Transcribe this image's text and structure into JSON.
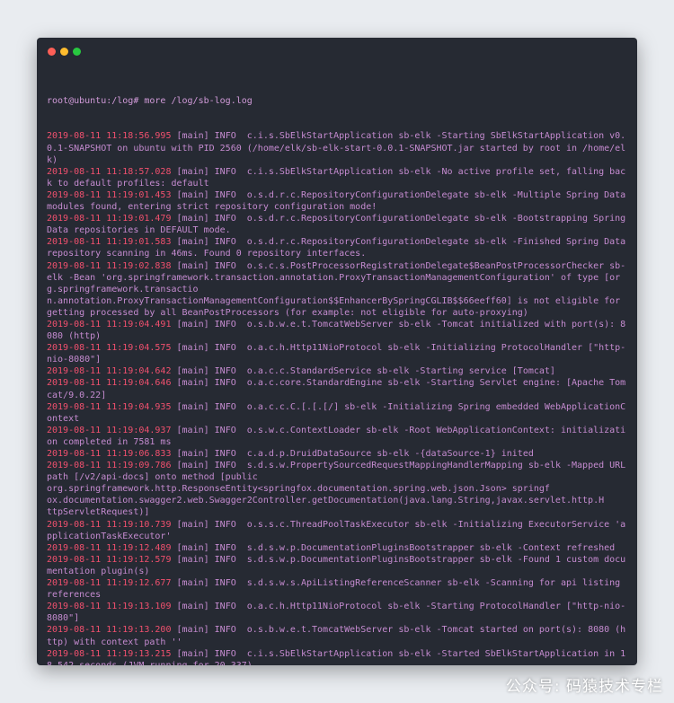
{
  "window": {
    "buttons": [
      "close",
      "minimize",
      "maximize"
    ]
  },
  "terminal": {
    "prompt": "root@ubuntu:/log# more /log/sb-log.log",
    "log": [
      {
        "ts": "2019-08-11 11:18:56.995",
        "msg": " [main] INFO  c.i.s.SbElkStartApplication sb-elk -Starting SbElkStartApplication v0.0.1-SNAPSHOT on ubuntu with PID 2560 (/home/elk/sb-elk-start-0.0.1-SNAPSHOT.jar started by root in /home/elk)"
      },
      {
        "ts": "2019-08-11 11:18:57.028",
        "msg": " [main] INFO  c.i.s.SbElkStartApplication sb-elk -No active profile set, falling back to default profiles: default"
      },
      {
        "ts": "2019-08-11 11:19:01.453",
        "msg": " [main] INFO  o.s.d.r.c.RepositoryConfigurationDelegate sb-elk -Multiple Spring Data modules found, entering strict repository configuration mode!"
      },
      {
        "ts": "2019-08-11 11:19:01.479",
        "msg": " [main] INFO  o.s.d.r.c.RepositoryConfigurationDelegate sb-elk -Bootstrapping Spring Data repositories in DEFAULT mode."
      },
      {
        "ts": "2019-08-11 11:19:01.583",
        "msg": " [main] INFO  o.s.d.r.c.RepositoryConfigurationDelegate sb-elk -Finished Spring Data repository scanning in 46ms. Found 0 repository interfaces."
      },
      {
        "ts": "2019-08-11 11:19:02.838",
        "msg": " [main] INFO  o.s.c.s.PostProcessorRegistrationDelegate$BeanPostProcessorChecker sb-elk -Bean 'org.springframework.transaction.annotation.ProxyTransactionManagementConfiguration' of type [org.springframework.transactio\nn.annotation.ProxyTransactionManagementConfiguration$$EnhancerBySpringCGLIB$$66eeff60] is not eligible for getting processed by all BeanPostProcessors (for example: not eligible for auto-proxying)"
      },
      {
        "ts": "2019-08-11 11:19:04.491",
        "msg": " [main] INFO  o.s.b.w.e.t.TomcatWebServer sb-elk -Tomcat initialized with port(s): 8080 (http)"
      },
      {
        "ts": "2019-08-11 11:19:04.575",
        "msg": " [main] INFO  o.a.c.h.Http11NioProtocol sb-elk -Initializing ProtocolHandler [\"http-nio-8080\"]"
      },
      {
        "ts": "2019-08-11 11:19:04.642",
        "msg": " [main] INFO  o.a.c.c.StandardService sb-elk -Starting service [Tomcat]"
      },
      {
        "ts": "2019-08-11 11:19:04.646",
        "msg": " [main] INFO  o.a.c.core.StandardEngine sb-elk -Starting Servlet engine: [Apache Tomcat/9.0.22]"
      },
      {
        "ts": "2019-08-11 11:19:04.935",
        "msg": " [main] INFO  o.a.c.c.C.[.[.[/] sb-elk -Initializing Spring embedded WebApplicationContext"
      },
      {
        "ts": "2019-08-11 11:19:04.937",
        "msg": " [main] INFO  o.s.w.c.ContextLoader sb-elk -Root WebApplicationContext: initialization completed in 7581 ms"
      },
      {
        "ts": "2019-08-11 11:19:06.833",
        "msg": " [main] INFO  c.a.d.p.DruidDataSource sb-elk -{dataSource-1} inited"
      },
      {
        "ts": "2019-08-11 11:19:09.786",
        "msg": " [main] INFO  s.d.s.w.PropertySourcedRequestMappingHandlerMapping sb-elk -Mapped URL path [/v2/api-docs] onto method [public\norg.springframework.http.ResponseEntity<springfox.documentation.spring.web.json.Json> springf\nox.documentation.swagger2.web.Swagger2Controller.getDocumentation(java.lang.String,javax.servlet.http.H\nttpServletRequest)]"
      },
      {
        "ts": "2019-08-11 11:19:10.739",
        "msg": " [main] INFO  o.s.s.c.ThreadPoolTaskExecutor sb-elk -Initializing ExecutorService 'applicationTaskExecutor'"
      },
      {
        "ts": "2019-08-11 11:19:12.489",
        "msg": " [main] INFO  s.d.s.w.p.DocumentationPluginsBootstrapper sb-elk -Context refreshed"
      },
      {
        "ts": "2019-08-11 11:19:12.579",
        "msg": " [main] INFO  s.d.s.w.p.DocumentationPluginsBootstrapper sb-elk -Found 1 custom documentation plugin(s)"
      },
      {
        "ts": "2019-08-11 11:19:12.677",
        "msg": " [main] INFO  s.d.s.w.s.ApiListingReferenceScanner sb-elk -Scanning for api listing references"
      },
      {
        "ts": "2019-08-11 11:19:13.109",
        "msg": " [main] INFO  o.a.c.h.Http11NioProtocol sb-elk -Starting ProtocolHandler [\"http-nio-8080\"]"
      },
      {
        "ts": "2019-08-11 11:19:13.200",
        "msg": " [main] INFO  o.s.b.w.e.t.TomcatWebServer sb-elk -Tomcat started on port(s): 8080 (http) with context path ''"
      },
      {
        "ts": "2019-08-11 11:19:13.215",
        "msg": " [main] INFO  c.i.s.SbElkStartApplication sb-elk -Started SbElkStartApplication in 18.542 seconds (JVM running for 20.337)"
      }
    ]
  },
  "watermark": {
    "text": "公众号: 码猿技术专栏"
  }
}
